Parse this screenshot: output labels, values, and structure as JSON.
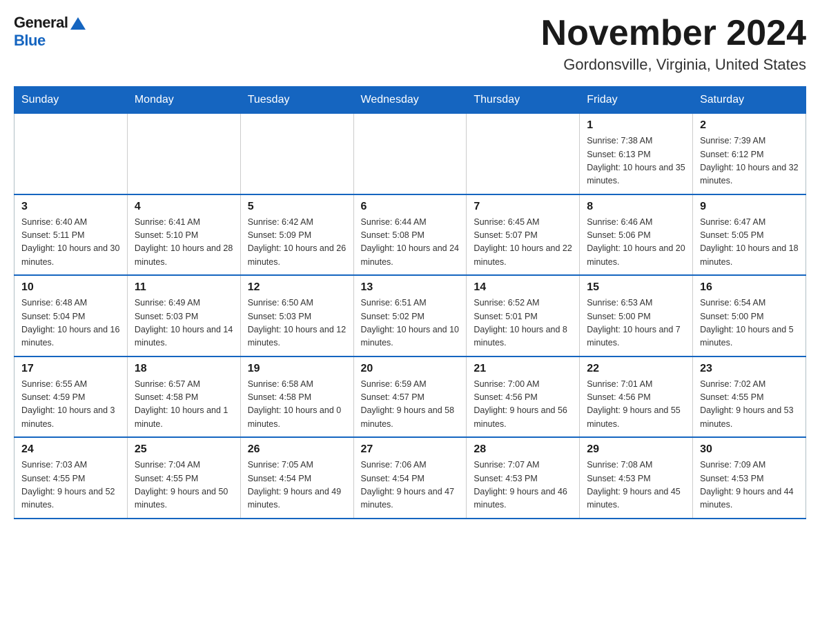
{
  "logo": {
    "general": "General",
    "blue": "Blue"
  },
  "title": "November 2024",
  "subtitle": "Gordonsville, Virginia, United States",
  "days_of_week": [
    "Sunday",
    "Monday",
    "Tuesday",
    "Wednesday",
    "Thursday",
    "Friday",
    "Saturday"
  ],
  "weeks": [
    [
      {
        "day": "",
        "info": ""
      },
      {
        "day": "",
        "info": ""
      },
      {
        "day": "",
        "info": ""
      },
      {
        "day": "",
        "info": ""
      },
      {
        "day": "",
        "info": ""
      },
      {
        "day": "1",
        "info": "Sunrise: 7:38 AM\nSunset: 6:13 PM\nDaylight: 10 hours and 35 minutes."
      },
      {
        "day": "2",
        "info": "Sunrise: 7:39 AM\nSunset: 6:12 PM\nDaylight: 10 hours and 32 minutes."
      }
    ],
    [
      {
        "day": "3",
        "info": "Sunrise: 6:40 AM\nSunset: 5:11 PM\nDaylight: 10 hours and 30 minutes."
      },
      {
        "day": "4",
        "info": "Sunrise: 6:41 AM\nSunset: 5:10 PM\nDaylight: 10 hours and 28 minutes."
      },
      {
        "day": "5",
        "info": "Sunrise: 6:42 AM\nSunset: 5:09 PM\nDaylight: 10 hours and 26 minutes."
      },
      {
        "day": "6",
        "info": "Sunrise: 6:44 AM\nSunset: 5:08 PM\nDaylight: 10 hours and 24 minutes."
      },
      {
        "day": "7",
        "info": "Sunrise: 6:45 AM\nSunset: 5:07 PM\nDaylight: 10 hours and 22 minutes."
      },
      {
        "day": "8",
        "info": "Sunrise: 6:46 AM\nSunset: 5:06 PM\nDaylight: 10 hours and 20 minutes."
      },
      {
        "day": "9",
        "info": "Sunrise: 6:47 AM\nSunset: 5:05 PM\nDaylight: 10 hours and 18 minutes."
      }
    ],
    [
      {
        "day": "10",
        "info": "Sunrise: 6:48 AM\nSunset: 5:04 PM\nDaylight: 10 hours and 16 minutes."
      },
      {
        "day": "11",
        "info": "Sunrise: 6:49 AM\nSunset: 5:03 PM\nDaylight: 10 hours and 14 minutes."
      },
      {
        "day": "12",
        "info": "Sunrise: 6:50 AM\nSunset: 5:03 PM\nDaylight: 10 hours and 12 minutes."
      },
      {
        "day": "13",
        "info": "Sunrise: 6:51 AM\nSunset: 5:02 PM\nDaylight: 10 hours and 10 minutes."
      },
      {
        "day": "14",
        "info": "Sunrise: 6:52 AM\nSunset: 5:01 PM\nDaylight: 10 hours and 8 minutes."
      },
      {
        "day": "15",
        "info": "Sunrise: 6:53 AM\nSunset: 5:00 PM\nDaylight: 10 hours and 7 minutes."
      },
      {
        "day": "16",
        "info": "Sunrise: 6:54 AM\nSunset: 5:00 PM\nDaylight: 10 hours and 5 minutes."
      }
    ],
    [
      {
        "day": "17",
        "info": "Sunrise: 6:55 AM\nSunset: 4:59 PM\nDaylight: 10 hours and 3 minutes."
      },
      {
        "day": "18",
        "info": "Sunrise: 6:57 AM\nSunset: 4:58 PM\nDaylight: 10 hours and 1 minute."
      },
      {
        "day": "19",
        "info": "Sunrise: 6:58 AM\nSunset: 4:58 PM\nDaylight: 10 hours and 0 minutes."
      },
      {
        "day": "20",
        "info": "Sunrise: 6:59 AM\nSunset: 4:57 PM\nDaylight: 9 hours and 58 minutes."
      },
      {
        "day": "21",
        "info": "Sunrise: 7:00 AM\nSunset: 4:56 PM\nDaylight: 9 hours and 56 minutes."
      },
      {
        "day": "22",
        "info": "Sunrise: 7:01 AM\nSunset: 4:56 PM\nDaylight: 9 hours and 55 minutes."
      },
      {
        "day": "23",
        "info": "Sunrise: 7:02 AM\nSunset: 4:55 PM\nDaylight: 9 hours and 53 minutes."
      }
    ],
    [
      {
        "day": "24",
        "info": "Sunrise: 7:03 AM\nSunset: 4:55 PM\nDaylight: 9 hours and 52 minutes."
      },
      {
        "day": "25",
        "info": "Sunrise: 7:04 AM\nSunset: 4:55 PM\nDaylight: 9 hours and 50 minutes."
      },
      {
        "day": "26",
        "info": "Sunrise: 7:05 AM\nSunset: 4:54 PM\nDaylight: 9 hours and 49 minutes."
      },
      {
        "day": "27",
        "info": "Sunrise: 7:06 AM\nSunset: 4:54 PM\nDaylight: 9 hours and 47 minutes."
      },
      {
        "day": "28",
        "info": "Sunrise: 7:07 AM\nSunset: 4:53 PM\nDaylight: 9 hours and 46 minutes."
      },
      {
        "day": "29",
        "info": "Sunrise: 7:08 AM\nSunset: 4:53 PM\nDaylight: 9 hours and 45 minutes."
      },
      {
        "day": "30",
        "info": "Sunrise: 7:09 AM\nSunset: 4:53 PM\nDaylight: 9 hours and 44 minutes."
      }
    ]
  ]
}
